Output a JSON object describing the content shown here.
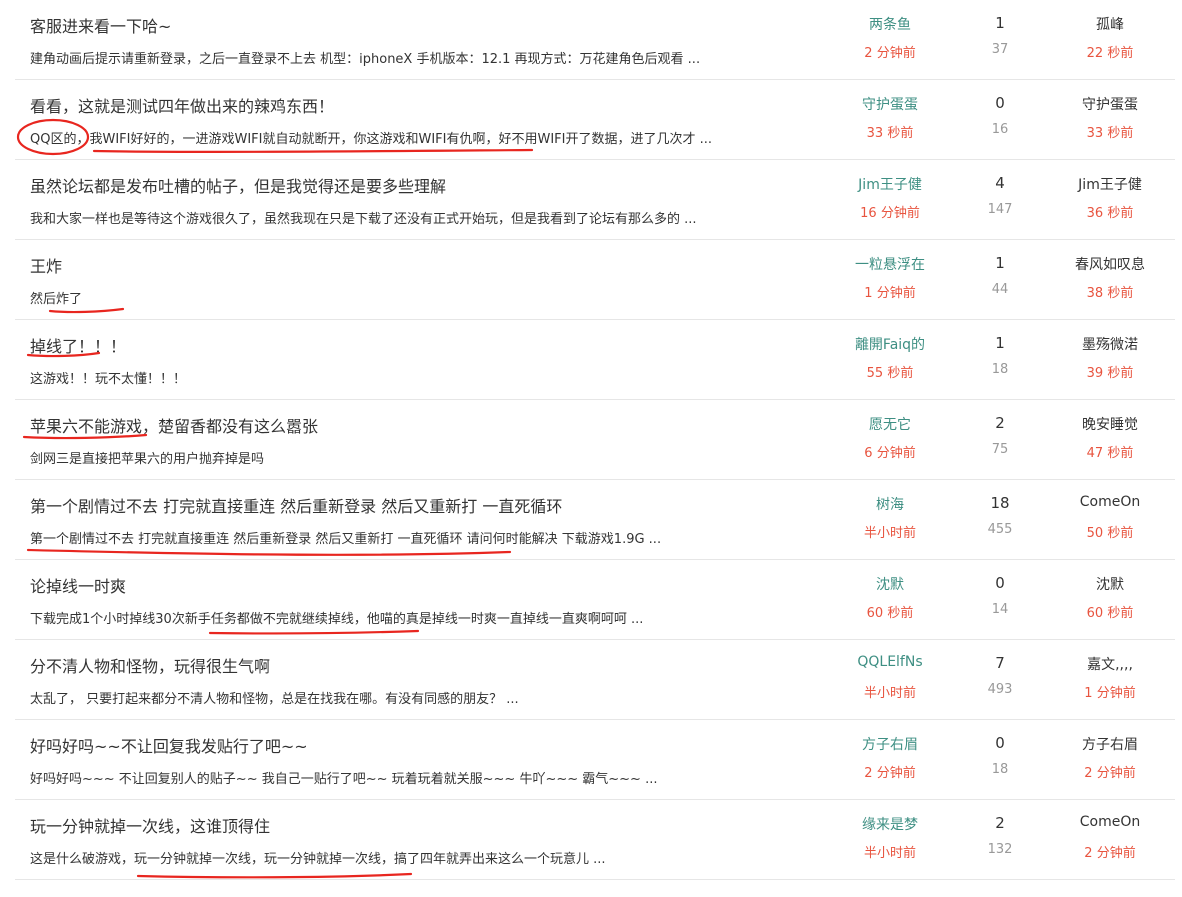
{
  "threads": [
    {
      "title": "客服进来看一下哈~",
      "excerpt": "建角动画后提示请重新登录，之后一直登录不上去 机型：iphoneX 手机版本：12.1 再现方式：万花建角色后观看 ...",
      "author": "两条鱼",
      "created": "2 分钟前",
      "replies": "1",
      "views": "37",
      "last_user": "孤峰",
      "last_time": "22 秒前"
    },
    {
      "title": "看看，这就是测试四年做出来的辣鸡东西！",
      "excerpt": "QQ区的，我WIFI好好的，一进游戏WIFI就自动就断开，你这游戏和WIFI有仇啊，好不用WIFI开了数据，进了几次才 ...",
      "author": "守护蛋蛋",
      "created": "33 秒前",
      "replies": "0",
      "views": "16",
      "last_user": "守护蛋蛋",
      "last_time": "33 秒前"
    },
    {
      "title": "虽然论坛都是发布吐槽的帖子，但是我觉得还是要多些理解",
      "excerpt": "我和大家一样也是等待这个游戏很久了，虽然我现在只是下载了还没有正式开始玩，但是我看到了论坛有那么多的 ...",
      "author": "Jim王子健",
      "created": "16 分钟前",
      "replies": "4",
      "views": "147",
      "last_user": "Jim王子健",
      "last_time": "36 秒前"
    },
    {
      "title": "王炸",
      "excerpt": "然后炸了",
      "author": "一粒悬浮在",
      "created": "1 分钟前",
      "replies": "1",
      "views": "44",
      "last_user": "春风如叹息",
      "last_time": "38 秒前"
    },
    {
      "title": "掉线了！！！",
      "excerpt": "这游戏！！玩不太懂！！！",
      "author": "離開Faiq的",
      "created": "55 秒前",
      "replies": "1",
      "views": "18",
      "last_user": "墨殇微渃",
      "last_time": "39 秒前"
    },
    {
      "title": "苹果六不能游戏，楚留香都没有这么嚣张",
      "excerpt": "剑网三是直接把苹果六的用户抛弃掉是吗",
      "author": "愿无它",
      "created": "6 分钟前",
      "replies": "2",
      "views": "75",
      "last_user": "晚安睡觉",
      "last_time": "47 秒前"
    },
    {
      "title": "第一个剧情过不去 打完就直接重连 然后重新登录 然后又重新打 一直死循环",
      "excerpt": "第一个剧情过不去 打完就直接重连 然后重新登录 然后又重新打 一直死循环 请问何时能解决 下载游戏1.9G ...",
      "author": "树海",
      "created": "半小时前",
      "replies": "18",
      "views": "455",
      "last_user": "ComeOn",
      "last_time": "50 秒前"
    },
    {
      "title": "论掉线一时爽",
      "excerpt": "下载完成1个小时掉线30次新手任务都做不完就继续掉线，他喵的真是掉线一时爽一直掉线一直爽啊呵呵 ...",
      "author": "沈默",
      "created": "60 秒前",
      "replies": "0",
      "views": "14",
      "last_user": "沈默",
      "last_time": "60 秒前"
    },
    {
      "title": "分不清人物和怪物，玩得很生气啊",
      "excerpt": "太乱了， 只要打起来都分不清人物和怪物，总是在找我在哪。有没有同感的朋友？ ...",
      "author": "QQLElfNs",
      "created": "半小时前",
      "replies": "7",
      "views": "493",
      "last_user": "嘉文,,,,",
      "last_time": "1 分钟前"
    },
    {
      "title": "好吗好吗~~不让回复我发贴行了吧~~",
      "excerpt": "好吗好吗~~~ 不让回复别人的贴子~~ 我自己一贴行了吧~~ 玩着玩着就关服~~~ 牛吖~~~ 霸气~~~ ...",
      "author": "方子右眉",
      "created": "2 分钟前",
      "replies": "0",
      "views": "18",
      "last_user": "方子右眉",
      "last_time": "2 分钟前"
    },
    {
      "title": "玩一分钟就掉一次线，这谁顶得住",
      "excerpt": "这是什么破游戏，玩一分钟就掉一次线，玩一分钟就掉一次线，搞了四年就弄出来这么一个玩意儿 ...",
      "author": "缘来是梦",
      "created": "半小时前",
      "replies": "2",
      "views": "132",
      "last_user": "ComeOn",
      "last_time": "2 分钟前"
    }
  ],
  "colors": {
    "author": "#3e8f83",
    "time": "#e8543f",
    "views": "#999999",
    "annotation": "#e8261f"
  }
}
